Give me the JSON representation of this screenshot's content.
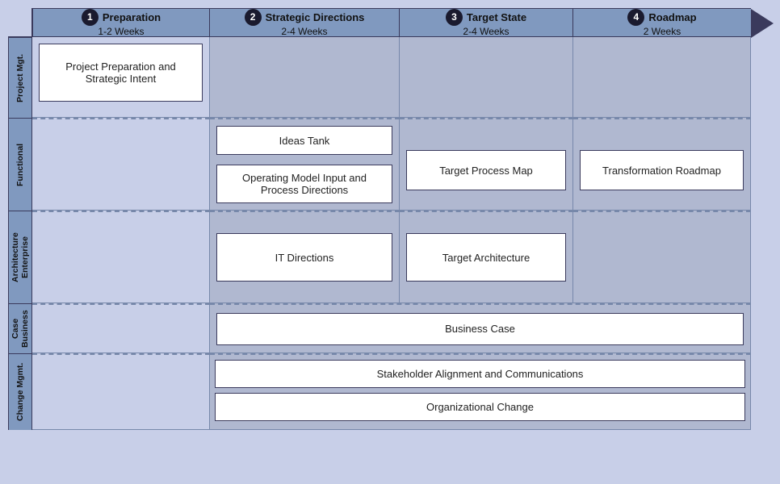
{
  "phases": [
    {
      "number": "1",
      "title": "Preparation",
      "duration": "1-2 Weeks"
    },
    {
      "number": "2",
      "title": "Strategic Directions",
      "duration": "2-4 Weeks"
    },
    {
      "number": "3",
      "title": "Target State",
      "duration": "2-4 Weeks"
    },
    {
      "number": "4",
      "title": "Roadmap",
      "duration": "2 Weeks"
    }
  ],
  "rows": [
    {
      "label": "Project Mgt."
    },
    {
      "label": "Functional"
    },
    {
      "label": "Enterprise Architecture"
    },
    {
      "label": "Business Case"
    },
    {
      "label": "Change Mgmt."
    }
  ],
  "boxes": {
    "project_prep": "Project Preparation and Strategic Intent",
    "ideas_tank": "Ideas Tank",
    "op_model": "Operating Model Input and Process Directions",
    "it_directions": "IT Directions",
    "target_process_map": "Target Process Map",
    "target_architecture": "Target Architecture",
    "transformation_roadmap": "Transformation Roadmap",
    "business_case": "Business Case",
    "stakeholder": "Stakeholder Alignment and Communications",
    "org_change": "Organizational Change"
  },
  "colors": {
    "bg": "#c8cfe8",
    "phase_header": "#7f99bf",
    "row_label": "#7f99bf",
    "cell_light": "#c8cfe8",
    "cell_medium": "#b0b8d2",
    "cell_dark": "#a0a8c4",
    "border_dark": "#2c3e6e",
    "border_med": "#778899",
    "white": "#ffffff",
    "text_dark": "#111111"
  }
}
